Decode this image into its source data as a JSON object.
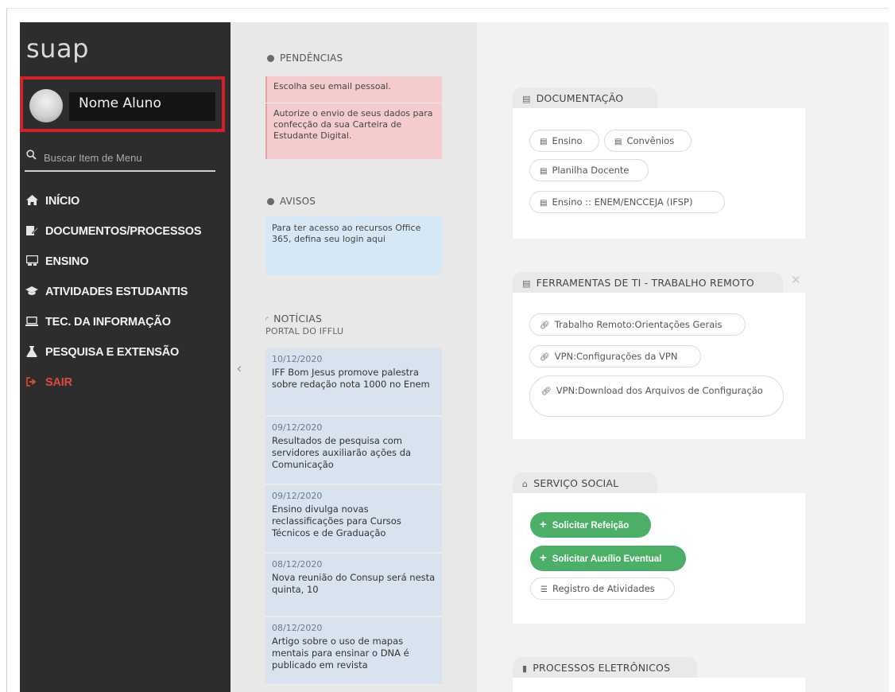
{
  "sidebar": {
    "logo": "suap",
    "user_name": "Nome Aluno",
    "search_placeholder": "Buscar Item de Menu",
    "items": [
      {
        "label": "INÍCIO",
        "icon": "home-icon"
      },
      {
        "label": "DOCUMENTOS/PROCESSOS",
        "icon": "documents-icon"
      },
      {
        "label": "ENSINO",
        "icon": "ensino-icon"
      },
      {
        "label": "ATIVIDADES ESTUDANTIS",
        "icon": "graduation-cap-icon"
      },
      {
        "label": "TEC. DA INFORMAÇÃO",
        "icon": "laptop-icon"
      },
      {
        "label": "PESQUISA E EXTENSÃO",
        "icon": "flask-icon"
      },
      {
        "label": "SAIR",
        "icon": "sign-out-icon"
      }
    ]
  },
  "pendencias": {
    "title": "PENDÊNCIAS",
    "items": [
      "Escolha seu email pessoal.",
      "Autorize o envio de seus dados para confecção da sua Carteira de Estudante Digital."
    ]
  },
  "avisos": {
    "title": "AVISOS",
    "items": [
      "Para ter acesso ao recursos Office 365, defina seu login aqui"
    ]
  },
  "noticias": {
    "title": "NOTÍCIAS",
    "subtitle": "PORTAL DO IFFLU",
    "items": [
      {
        "date": "10/12/2020",
        "title": "IFF Bom Jesus promove palestra sobre redação nota 1000 no Enem"
      },
      {
        "date": "09/12/2020",
        "title": "Resultados de pesquisa com servidores auxiliarão ações da Comunicação"
      },
      {
        "date": "09/12/2020",
        "title": "Ensino divulga novas reclassificações para Cursos Técnicos e de Graduação"
      },
      {
        "date": "08/12/2020",
        "title": "Nova reunião do Consup será nesta quinta, 10"
      },
      {
        "date": "08/12/2020",
        "title": "Artigo sobre o uso de mapas mentais para ensinar o DNA é publicado em revista"
      }
    ]
  },
  "documentacao": {
    "title": "DOCUMENTAÇÃO",
    "links": [
      "Ensino",
      "Convênios",
      "Planilha Docente",
      "Ensino :: ENEM/ENCCEJA (IFSP)"
    ]
  },
  "ferramentas": {
    "title": "FERRAMENTAS DE TI - TRABALHO REMOTO",
    "close": "✕",
    "links": [
      "Trabalho Remoto:Orientações Gerais",
      "VPN:Configurações da VPN",
      "VPN:Download dos Arquivos de Configuração"
    ]
  },
  "servico_social": {
    "title": "SERVIÇO SOCIAL",
    "buttons": [
      "Solicitar Refeição",
      "Solicitar Auxílio Eventual"
    ],
    "link": "Registro de Atividades"
  },
  "processos": {
    "title": "PROCESSOS ELETRÔNICOS"
  },
  "colors": {
    "sidebar_bg": "#2d2d2d",
    "accent_red": "#d3202a",
    "sair_red": "#e0493f",
    "green": "#4caf68",
    "pendencia_bg": "#f4cccd",
    "aviso_bg": "#d6e8f5",
    "noticia_bg": "#d8e3ef"
  }
}
